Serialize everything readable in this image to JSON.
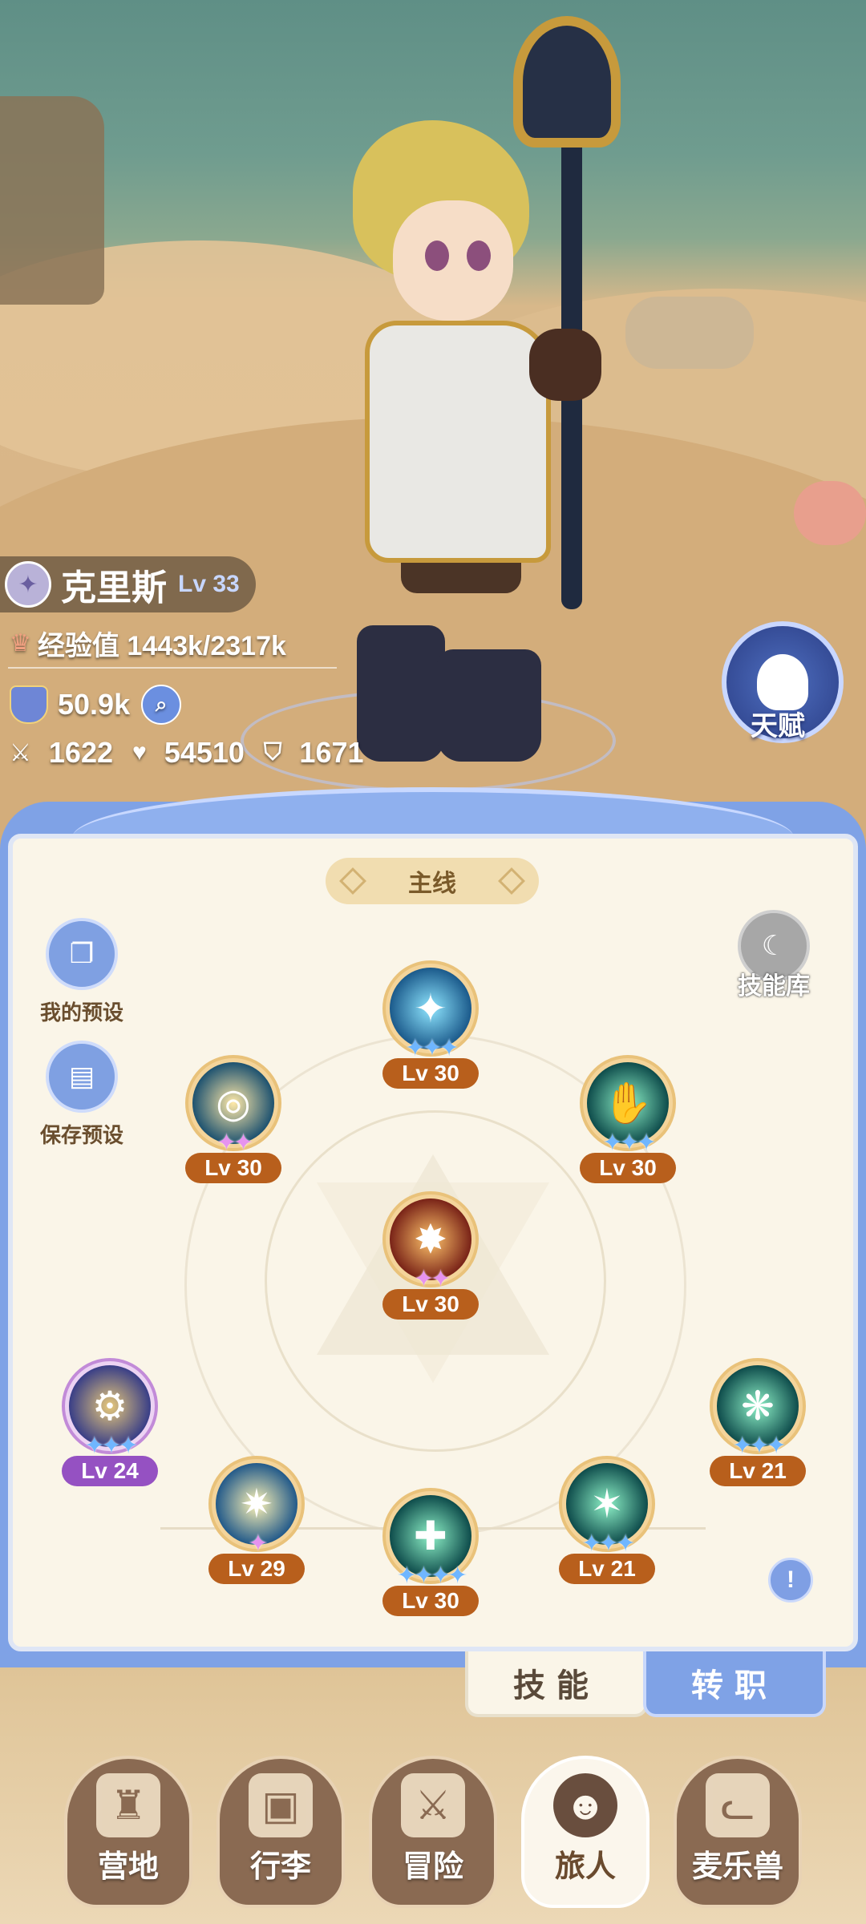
{
  "character": {
    "name": "克里斯",
    "level": "Lv 33",
    "exp_label": "经验值 1443k/2317k",
    "power": "50.9k",
    "attack": "1622",
    "hp": "54510",
    "defense": "1671"
  },
  "talent": {
    "label": "天赋",
    "icon": "brain-head-icon"
  },
  "panel": {
    "section_title": "主线",
    "my_presets": "我的预设",
    "save_presets": "保存预设",
    "skill_library": "技能库",
    "info": "!"
  },
  "skills": [
    {
      "id": "top",
      "level": "Lv 30",
      "stars": "✦✦✦",
      "star_color": "blue",
      "theme": "blue",
      "icon": "✦"
    },
    {
      "id": "upper-left",
      "level": "Lv 30",
      "stars": "✦✦",
      "star_color": "pink",
      "theme": "gold",
      "icon": "◎"
    },
    {
      "id": "upper-right",
      "level": "Lv 30",
      "stars": "✦✦✦",
      "star_color": "blue",
      "theme": "green",
      "icon": "✋"
    },
    {
      "id": "center",
      "level": "Lv 30",
      "stars": "✦✦",
      "star_color": "pink",
      "theme": "fire",
      "icon": "✸"
    },
    {
      "id": "row-a",
      "level": "Lv 24",
      "stars": "✦✦✦",
      "star_color": "blue",
      "theme": "violet",
      "icon": "⚙"
    },
    {
      "id": "row-b",
      "level": "Lv 29",
      "stars": "✦",
      "star_color": "pink",
      "theme": "light",
      "icon": "✷"
    },
    {
      "id": "row-c",
      "level": "Lv 30",
      "stars": "✦✦✦✦",
      "star_color": "blue",
      "theme": "green",
      "icon": "✚"
    },
    {
      "id": "row-d",
      "level": "Lv 21",
      "stars": "✦✦✦",
      "star_color": "blue",
      "theme": "green",
      "icon": "✶"
    },
    {
      "id": "row-e",
      "level": "Lv 21",
      "stars": "✦✦✦",
      "star_color": "blue",
      "theme": "green",
      "icon": "❋"
    }
  ],
  "tabs": {
    "skill": "技能",
    "job": "转职"
  },
  "nav": [
    {
      "label": "营地",
      "icon": "castle-icon"
    },
    {
      "label": "行李",
      "icon": "backpack-icon"
    },
    {
      "label": "冒险",
      "icon": "crossed-swords-icon"
    },
    {
      "label": "旅人",
      "icon": "traveler-portrait-icon"
    },
    {
      "label": "麦乐兽",
      "icon": "cat-beast-icon"
    }
  ],
  "colors": {
    "accent_blue": "#7fa2e6",
    "level_badge": "#b85f1c",
    "level_badge_purple": "#9551c2"
  }
}
